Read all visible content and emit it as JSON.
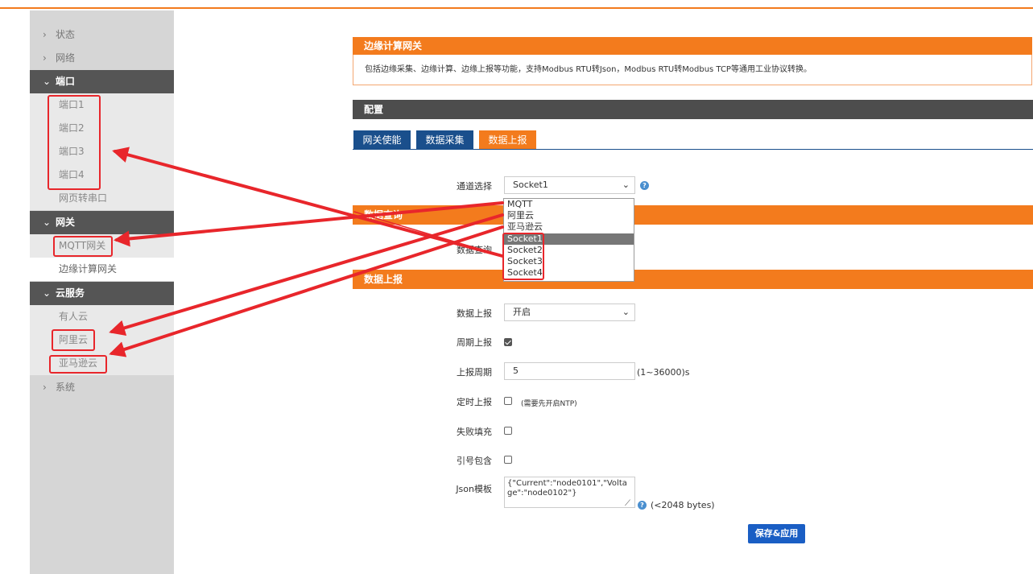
{
  "sidebar": {
    "items": [
      {
        "label": "状态",
        "kind": "top",
        "icon": "chevron-right-icon"
      },
      {
        "label": "网络",
        "kind": "top",
        "icon": "chevron-right-icon"
      },
      {
        "label": "端口",
        "kind": "group",
        "icon": "chevron-down-icon"
      },
      {
        "label": "端口1",
        "kind": "sub"
      },
      {
        "label": "端口2",
        "kind": "sub"
      },
      {
        "label": "端口3",
        "kind": "sub"
      },
      {
        "label": "端口4",
        "kind": "sub"
      },
      {
        "label": "网页转串口",
        "kind": "sub"
      },
      {
        "label": "网关",
        "kind": "group",
        "icon": "chevron-down-icon"
      },
      {
        "label": "MQTT网关",
        "kind": "sub"
      },
      {
        "label": "边缘计算网关",
        "kind": "sub-active"
      },
      {
        "label": "云服务",
        "kind": "group",
        "icon": "chevron-down-icon"
      },
      {
        "label": "有人云",
        "kind": "sub"
      },
      {
        "label": "阿里云",
        "kind": "sub"
      },
      {
        "label": "亚马逊云",
        "kind": "sub"
      },
      {
        "label": "系统",
        "kind": "top",
        "icon": "chevron-right-icon"
      }
    ]
  },
  "gateway": {
    "title": "边缘计算网关",
    "description": "包括边缘采集、边缘计算、边缘上报等功能，支持Modbus RTU转Json，Modbus RTU转Modbus TCP等通用工业协议转换。"
  },
  "config": {
    "title": "配置",
    "tabs": [
      "网关使能",
      "数据采集",
      "数据上报"
    ],
    "active_tab": "数据上报"
  },
  "channel": {
    "label": "通道选择",
    "value": "Socket1",
    "options": [
      "MQTT",
      "阿里云",
      "亚马逊云",
      "Socket1",
      "Socket2",
      "Socket3",
      "Socket4"
    ],
    "selected_option": "Socket1"
  },
  "query_section": {
    "title": "数据查询",
    "field_label": "数据查询"
  },
  "report_section": {
    "title": "数据上报",
    "report_label": "数据上报",
    "report_value": "开启",
    "periodic_label": "周期上报",
    "periodic_checked": true,
    "period_label": "上报周期",
    "period_value": "5",
    "period_hint": "(1~36000)s",
    "timed_label": "定时上报",
    "timed_checked": false,
    "timed_hint": "(需要先开启NTP)",
    "fail_fill_label": "失败填充",
    "fail_fill_checked": false,
    "quote_label": "引号包含",
    "quote_checked": false,
    "json_label": "Json模板",
    "json_value": "{\"Current\":\"node0101\",\"Voltage\":\"node0102\"}",
    "json_hint": "(<2048 bytes)"
  },
  "save_button": "保存&应用",
  "icons": {
    "help": "?",
    "dropdown_arrow": "⌄"
  },
  "colors": {
    "accent": "#f37b1d",
    "tab_blue": "#1a4f8c",
    "button_blue": "#1a5ec4",
    "highlight_red": "#e8262b",
    "sidebar_dark": "#555555"
  }
}
